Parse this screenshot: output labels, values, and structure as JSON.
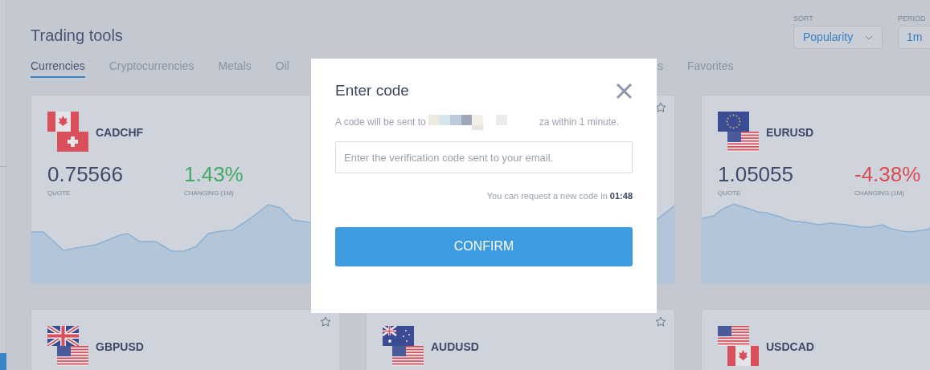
{
  "page": {
    "title": "Trading tools"
  },
  "sort": {
    "label": "SORT",
    "value": "Popularity"
  },
  "period": {
    "label": "PERIOD",
    "value": "1m"
  },
  "tabs": [
    {
      "label": "Currencies",
      "selected": true
    },
    {
      "label": "Cryptocurrencies",
      "selected": false
    },
    {
      "label": "Metals",
      "selected": false
    },
    {
      "label": "Oil",
      "selected": false
    },
    {
      "label": "s",
      "selected": false
    },
    {
      "label": "Favorites",
      "selected": false
    }
  ],
  "cards": [
    {
      "pair": "CADCHF",
      "quote": "0.75566",
      "quote_label": "QUOTE",
      "change": "1.43%",
      "change_label": "CHANGING (1M)",
      "color": "#45a865"
    },
    {
      "favorite": false
    },
    {
      "pair": "EURUSD",
      "quote": "1.05055",
      "quote_label": "QUOTE",
      "change": "-4.38%",
      "change_label": "CHANGING (1M)",
      "color": "#d94b55"
    },
    {
      "pair": "GBPUSD",
      "favorite": false
    },
    {
      "pair": "AUDUSD",
      "favorite": false
    },
    {
      "pair": "USDCAD"
    }
  ],
  "dialog": {
    "title": "Enter code",
    "message_start": "A code will be sent to",
    "message_end": "za within 1 minute.",
    "code_field": {
      "placeholder": "Enter the verification code sent to your email."
    },
    "resend_note": "You can request a new code in **01:48**",
    "confirm_button": "CONFIRM"
  }
}
